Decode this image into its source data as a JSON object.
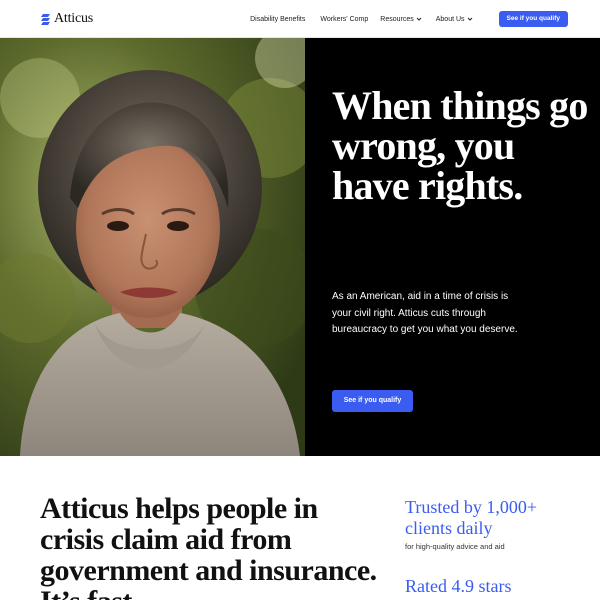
{
  "nav": {
    "logo": "Atticus",
    "links": [
      "Disability Benefits",
      "Workers' Comp",
      "Resources",
      "About Us"
    ],
    "cta": "See if you qualify"
  },
  "hero": {
    "title": "When things go wrong, you have rights.",
    "body": "As an American, aid in a time of crisis is your civil right. Atticus cuts through bureaucracy to get you what you deserve.",
    "cta": "See if you qualify"
  },
  "lower": {
    "heading": "Atticus helps people in crisis claim aid from government and insurance. It’s fast,",
    "stats": [
      {
        "title": "Trusted by 1,000+ clients daily",
        "subtitle": "for high-quality advice and aid"
      },
      {
        "title": "Rated 4.9 stars",
        "subtitle": ""
      }
    ]
  },
  "colors": {
    "accent": "#3a5cf0",
    "hero_panel": "#000000"
  },
  "icons": [
    "atticus-logo-icon",
    "chevron-down-icon"
  ]
}
